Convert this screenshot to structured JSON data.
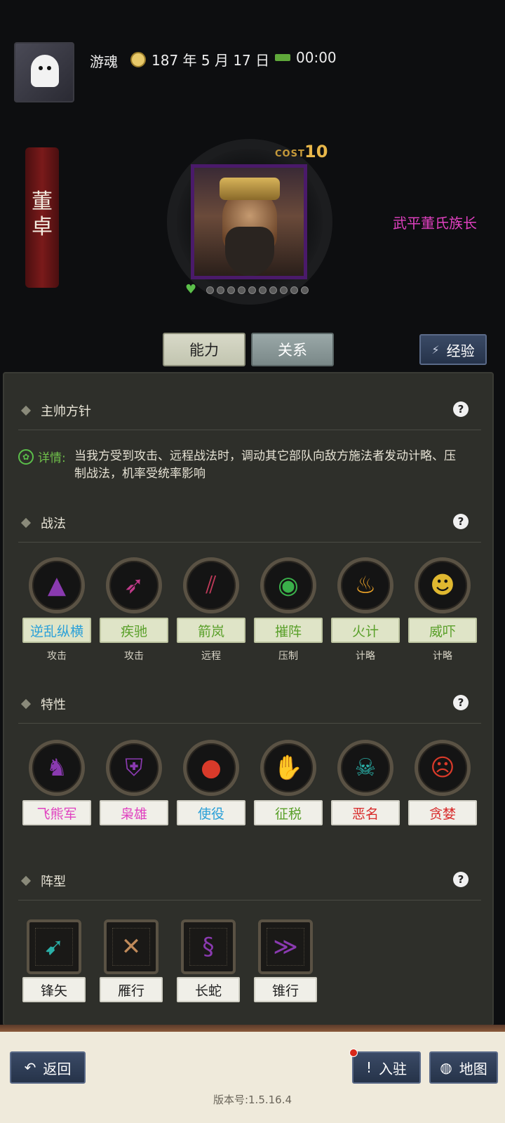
{
  "header": {
    "player_name": "游魂",
    "date": "187 年 5 月 17 日",
    "time": "00:00"
  },
  "hero": {
    "name": "董卓",
    "cost_label": "COST",
    "cost_value": "10",
    "title": "武平董氏族长",
    "title_color": "#e040c0",
    "stars_total": 10
  },
  "tabs": {
    "ability": "能力",
    "relation": "关系",
    "experience": "经验"
  },
  "sections": {
    "commander": {
      "title": "主帅方针",
      "detail_label": "详情:",
      "detail_text": "当我方受到攻击、远程战法时，调动其它部队向敌方施法者发动计略、压制战法，机率受统率影响"
    },
    "tactics": {
      "title": "战法",
      "items": [
        {
          "name": "逆乱纵横",
          "type": "攻击",
          "color": "#2aa0d8",
          "icon": "bear-claw-icon",
          "glyph": "▲",
          "glyph_color": "#8a3ab0"
        },
        {
          "name": "疾驰",
          "type": "攻击",
          "color": "#5aa02a",
          "icon": "arrows-icon",
          "glyph": "➶",
          "glyph_color": "#c03a8a"
        },
        {
          "name": "箭岚",
          "type": "远程",
          "color": "#5aa02a",
          "icon": "arrow-rain-icon",
          "glyph": "⫽",
          "glyph_color": "#c03a5a"
        },
        {
          "name": "摧阵",
          "type": "压制",
          "color": "#5aa02a",
          "icon": "eye-burst-icon",
          "glyph": "◉",
          "glyph_color": "#3ab04a"
        },
        {
          "name": "火计",
          "type": "计略",
          "color": "#5aa02a",
          "icon": "fire-icon",
          "glyph": "♨",
          "glyph_color": "#e8a028"
        },
        {
          "name": "威吓",
          "type": "计略",
          "color": "#5aa02a",
          "icon": "roar-face-icon",
          "glyph": "☻",
          "glyph_color": "#e0b830"
        }
      ]
    },
    "traits": {
      "title": "特性",
      "items": [
        {
          "name": "飞熊军",
          "color": "#e040c0",
          "icon": "bear-icon",
          "glyph": "♞",
          "glyph_color": "#8a3ab0"
        },
        {
          "name": "枭雄",
          "color": "#e040c0",
          "icon": "helmet-icon",
          "glyph": "⛨",
          "glyph_color": "#8a3ab0"
        },
        {
          "name": "使役",
          "color": "#2aa0d8",
          "icon": "boulder-icon",
          "glyph": "●",
          "glyph_color": "#d83a2a"
        },
        {
          "name": "征税",
          "color": "#5aa02a",
          "icon": "hand-coins-icon",
          "glyph": "✋",
          "glyph_color": "#2a8ad8"
        },
        {
          "name": "恶名",
          "color": "#d82a2a",
          "icon": "hooded-face-icon",
          "glyph": "☠",
          "glyph_color": "#2ab0a8"
        },
        {
          "name": "贪婪",
          "color": "#d82a2a",
          "icon": "greedy-face-icon",
          "glyph": "☹",
          "glyph_color": "#d83a2a"
        }
      ]
    },
    "formations": {
      "title": "阵型",
      "items": [
        {
          "name": "锋矢",
          "icon": "arrowhead-formation-icon",
          "glyph": "➹",
          "glyph_color": "#2ab0a8"
        },
        {
          "name": "雁行",
          "icon": "crossed-formation-icon",
          "glyph": "✕",
          "glyph_color": "#c08a5a"
        },
        {
          "name": "长蛇",
          "icon": "snake-formation-icon",
          "glyph": "§",
          "glyph_color": "#8a3ab0"
        },
        {
          "name": "锥行",
          "icon": "cone-formation-icon",
          "glyph": "≫",
          "glyph_color": "#8a3ab0"
        }
      ]
    }
  },
  "bottom": {
    "back": "返回",
    "station": "入驻",
    "map": "地图",
    "version": "版本号:1.5.16.4"
  }
}
